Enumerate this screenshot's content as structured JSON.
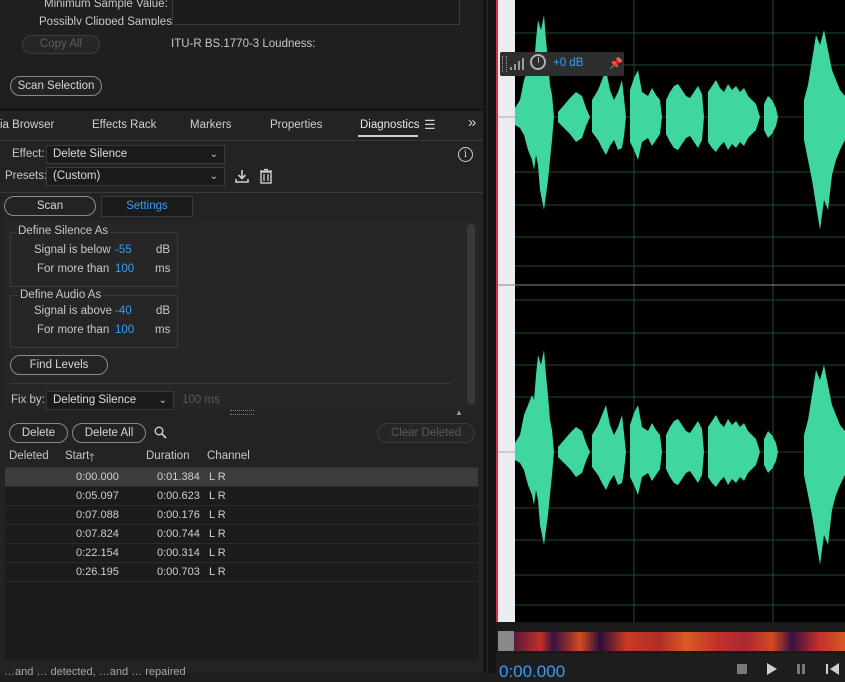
{
  "top_panel": {
    "min_sample_label": "Minimum Sample Value:",
    "clipped_label": "Possibly Clipped Samples:",
    "copy_all": "Copy All",
    "loudness_label": "ITU-R BS.1770-3 Loudness:",
    "scan_selection": "Scan Selection"
  },
  "tabs": [
    "ia Browser",
    "Effects Rack",
    "Markers",
    "Properties",
    "Diagnostics"
  ],
  "effect": {
    "label": "Effect:",
    "value": "Delete Silence"
  },
  "presets": {
    "label": "Presets:",
    "value": "(Custom)"
  },
  "mode_tabs": {
    "scan": "Scan",
    "settings": "Settings"
  },
  "silence": {
    "title": "Define Silence As",
    "signal_label": "Signal is below",
    "signal_value": "-55",
    "signal_unit": "dB",
    "more_label": "For more than",
    "more_value": "100",
    "more_unit": "ms"
  },
  "audio": {
    "title": "Define Audio As",
    "signal_label": "Signal is above",
    "signal_value": "-40",
    "signal_unit": "dB",
    "more_label": "For more than",
    "more_value": "100",
    "more_unit": "ms"
  },
  "find_levels": "Find Levels",
  "fix_by": {
    "label": "Fix by:",
    "value": "Deleting Silence",
    "hint": "100 ms"
  },
  "actions": {
    "delete": "Delete",
    "delete_all": "Delete All",
    "clear_deleted": "Clear Deleted"
  },
  "table": {
    "headers": [
      "Deleted",
      "Start",
      "Duration",
      "Channel"
    ],
    "rows": [
      {
        "start": "0:00.000",
        "duration": "0:01.384",
        "channel": "L R"
      },
      {
        "start": "0:05.097",
        "duration": "0:00.623",
        "channel": "L R"
      },
      {
        "start": "0:07.088",
        "duration": "0:00.176",
        "channel": "L R"
      },
      {
        "start": "0:07.824",
        "duration": "0:00.744",
        "channel": "L R"
      },
      {
        "start": "0:22.154",
        "duration": "0:00.314",
        "channel": "L R"
      },
      {
        "start": "0:26.195",
        "duration": "0:00.703",
        "channel": "L R"
      }
    ]
  },
  "status_text": "…and … detected, …and … repaired",
  "hud": {
    "gain": "+0 dB"
  },
  "timecode": "0:00.000",
  "colors": {
    "accent": "#3b9cf5",
    "waveform": "#3fd6a0",
    "background": "#1e1e1e"
  }
}
